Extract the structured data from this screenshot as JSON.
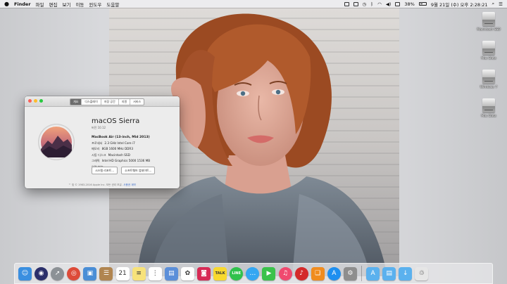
{
  "menubar": {
    "app": "Finder",
    "items": [
      "파일",
      "편집",
      "보기",
      "이동",
      "윈도우",
      "도움말"
    ],
    "battery": "38%",
    "clock": "9월 21일 (수) 오후 2:28:21"
  },
  "disks": [
    "Macintosh SSD",
    "Mac Data",
    "Windows 7",
    "Mac Data"
  ],
  "about": {
    "tabs": [
      "개요",
      "디스플레이",
      "저장 공간",
      "지원",
      "서비스"
    ],
    "os_name": "macOS Sierra",
    "os_version": "버전 10.12",
    "model": "MacBook Air (13-inch, Mid 2013)",
    "specs": [
      {
        "k": "프로세서",
        "v": "2.3 GHz Intel Core i7"
      },
      {
        "k": "메모리",
        "v": "8GB 1600 MHz DDR3"
      },
      {
        "k": "시동 디스크",
        "v": "Macintosh SSD"
      },
      {
        "k": "그래픽",
        "v": "Intel HD Graphics 5000 1536 MB"
      },
      {
        "k": "일련 번호",
        "v": ""
      }
    ],
    "buttons": [
      "시스템 리포트...",
      "소프트웨어 업데이트..."
    ],
    "copyright": "™ 및 © 1983-2016 Apple Inc. 모든 권리 보유.",
    "license_link": "사용권 계약"
  },
  "dock": {
    "apps": [
      {
        "name": "finder",
        "glyph": "☺",
        "color": "#3a8fe0"
      },
      {
        "name": "siri",
        "glyph": "◉",
        "color": "#2b2f6b"
      },
      {
        "name": "launchpad",
        "glyph": "➚",
        "color": "#8c9196"
      },
      {
        "name": "chrome",
        "glyph": "◎",
        "color": "#dd4b39"
      },
      {
        "name": "preview",
        "glyph": "▣",
        "color": "#4a8ed6"
      },
      {
        "name": "contacts",
        "glyph": "☰",
        "color": "#b08550"
      },
      {
        "name": "calendar",
        "glyph": "21",
        "color": "#ffffff"
      },
      {
        "name": "notes",
        "glyph": "≡",
        "color": "#f7e27a"
      },
      {
        "name": "reminders",
        "glyph": "⋮",
        "color": "#ffffff"
      },
      {
        "name": "keynote",
        "glyph": "▤",
        "color": "#5b8fd9"
      },
      {
        "name": "photos",
        "glyph": "✿",
        "color": "#ffffff"
      },
      {
        "name": "photo-booth",
        "glyph": "◙",
        "color": "#d72a55"
      },
      {
        "name": "kakaotalk",
        "glyph": "TALK",
        "color": "#f8d92f"
      },
      {
        "name": "line",
        "glyph": "LINE",
        "color": "#30c24c"
      },
      {
        "name": "messages",
        "glyph": "…",
        "color": "#35a7f2"
      },
      {
        "name": "facetime",
        "glyph": "▶",
        "color": "#3ac24b"
      },
      {
        "name": "itunes",
        "glyph": "♫",
        "color": "#f04a6f"
      },
      {
        "name": "netease-music",
        "glyph": "♪",
        "color": "#d42a2a"
      },
      {
        "name": "ibooks",
        "glyph": "❑",
        "color": "#f08c1f"
      },
      {
        "name": "app-store",
        "glyph": "A",
        "color": "#1e8ff0"
      },
      {
        "name": "system-preferences",
        "glyph": "⚙",
        "color": "#8e8e8e"
      }
    ],
    "folders": [
      {
        "name": "applications-folder",
        "glyph": "A",
        "color": "#5bb1ee"
      },
      {
        "name": "documents-folder",
        "glyph": "▤",
        "color": "#5bb1ee"
      },
      {
        "name": "downloads-folder",
        "glyph": "↓",
        "color": "#5bb1ee"
      }
    ],
    "trash": {
      "name": "trash",
      "glyph": "♲",
      "color": "#e6e6e6"
    }
  }
}
